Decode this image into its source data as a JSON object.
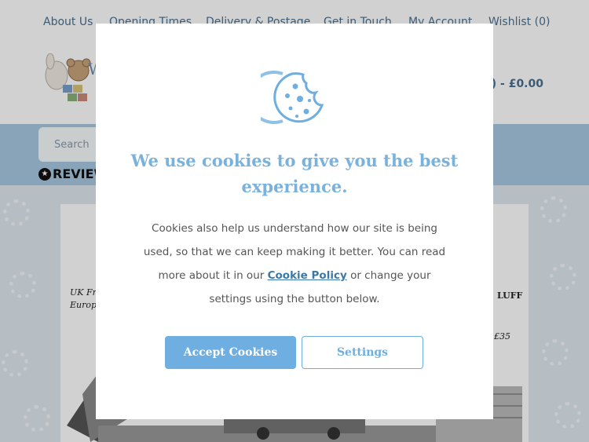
{
  "topnav": {
    "items": [
      "About Us",
      "Opening Times",
      "Delivery & Postage",
      "Get in Touch",
      "My Account",
      "Wishlist (0)"
    ]
  },
  "header": {
    "logo_text": "W",
    "basket": "0) - £0.00"
  },
  "search": {
    "placeholder": "Search"
  },
  "reviews": {
    "label": "REVIEW"
  },
  "card": {
    "art_text_left": "UK Fr",
    "art_text_left2": "Europ",
    "art_text_right": "LUFF",
    "art_text_price": "£35"
  },
  "modal": {
    "title": "We use cookies to give you the best experience.",
    "body_before": "Cookies also help us understand how our site is being used, so that we can keep making it better. You can read more about it in our",
    "policy_link": "Cookie Policy",
    "body_after": "or change your settings using the button below.",
    "accept_label": "Accept Cookies",
    "settings_label": "Settings"
  },
  "colors": {
    "accent": "#6eaee0",
    "title": "#7ab2de",
    "search_band": "#a8c8e2"
  },
  "icons": [
    "cookie-icon",
    "star-icon",
    "logo-image"
  ]
}
